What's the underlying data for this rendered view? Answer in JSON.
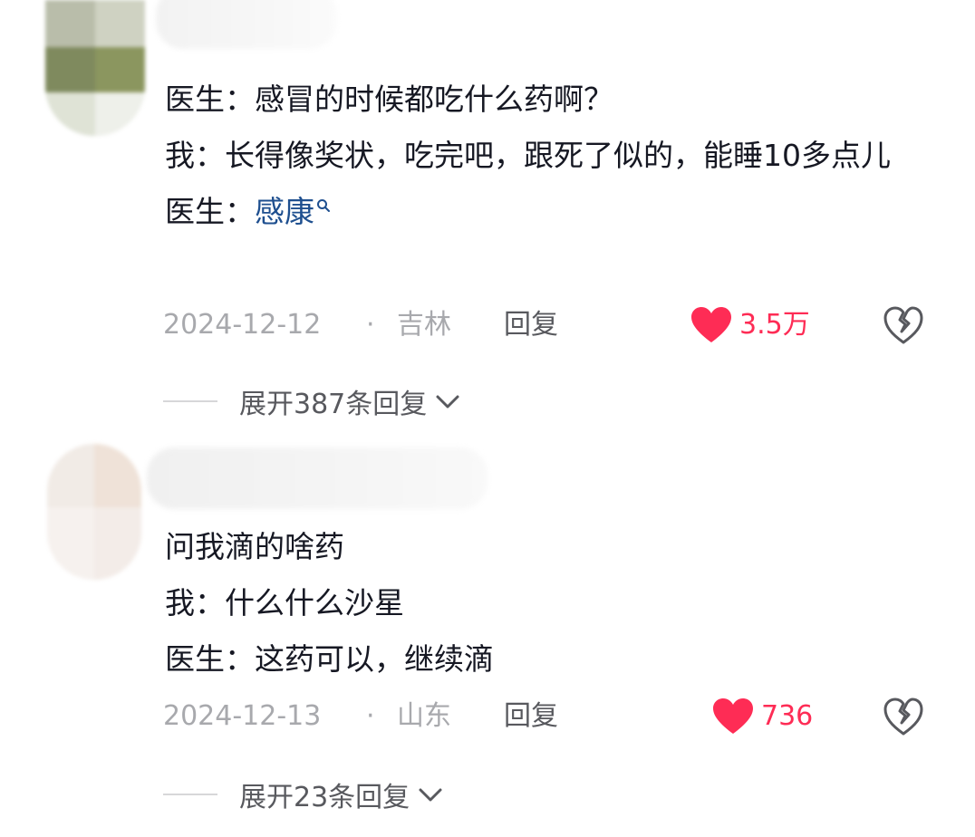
{
  "comments": [
    {
      "lines": [
        "医生：感冒的时候都吃什么药啊？",
        "我：长得像奖状，吃完吧，跟死了似的，能睡10多点儿"
      ],
      "last_line_prefix": "医生：",
      "last_line_link": "感康",
      "date": "2024-12-12",
      "separator": "·",
      "region": "吉林",
      "reply_label": "回复",
      "likes": "3.5万",
      "expand_label": "展开387条回复"
    },
    {
      "lines": [
        "问我滴的啥药",
        "我：什么什么沙星",
        "医生：这药可以，继续滴"
      ],
      "date": "2024-12-13",
      "separator": "·",
      "region": "山东",
      "reply_label": "回复",
      "likes": "736",
      "expand_label": "展开23条回复"
    }
  ],
  "colors": {
    "text": "#161823",
    "meta": "#a8a9ad",
    "like": "#fe2c55",
    "link": "#1e4f8f"
  },
  "icons": {
    "like": "heart-icon",
    "dislike": "broken-heart-icon",
    "expand": "chevron-down-icon",
    "link": "search-icon"
  }
}
